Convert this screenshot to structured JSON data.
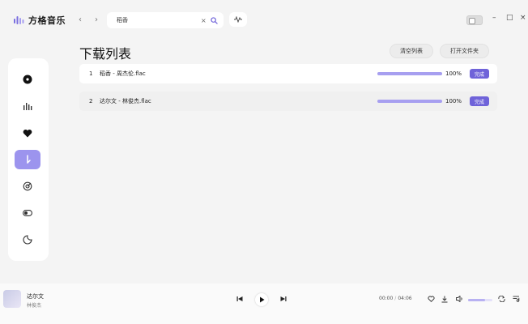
{
  "app": {
    "name": "方格音乐"
  },
  "nav": {
    "back": "‹",
    "forward": "›"
  },
  "search": {
    "value": "稻香",
    "clear": "×"
  },
  "window": {
    "minimize": "–",
    "maximize": "□",
    "close": "×"
  },
  "sidebar": {
    "items": [
      {
        "icon": "disc-icon",
        "active": false
      },
      {
        "icon": "chart-icon",
        "active": false
      },
      {
        "icon": "heart-icon",
        "active": false
      },
      {
        "icon": "download-icon",
        "active": true
      },
      {
        "icon": "radar-icon",
        "active": false
      },
      {
        "icon": "toggle-icon",
        "active": false
      },
      {
        "icon": "theme-icon",
        "active": false
      }
    ]
  },
  "page": {
    "title": "下载列表",
    "clear_label": "清空列表",
    "open_folder_label": "打开文件夹"
  },
  "downloads": [
    {
      "index": "1",
      "filename": "稻香 - 周杰伦.flac",
      "progress": 1.0,
      "percent": "100%",
      "status": "完成"
    },
    {
      "index": "2",
      "filename": "达尔文 - 林俊杰.flac",
      "progress": 1.0,
      "percent": "100%",
      "status": "完成"
    }
  ],
  "player": {
    "song": "达尔文",
    "artist": "林俊杰",
    "time_current": "00:00",
    "time_separator": "/",
    "time_total": "04:06",
    "volume": 0.7
  },
  "colors": {
    "accent": "#6f63d9",
    "accent_light": "#9c94ee",
    "progress": "#a79ff0"
  }
}
